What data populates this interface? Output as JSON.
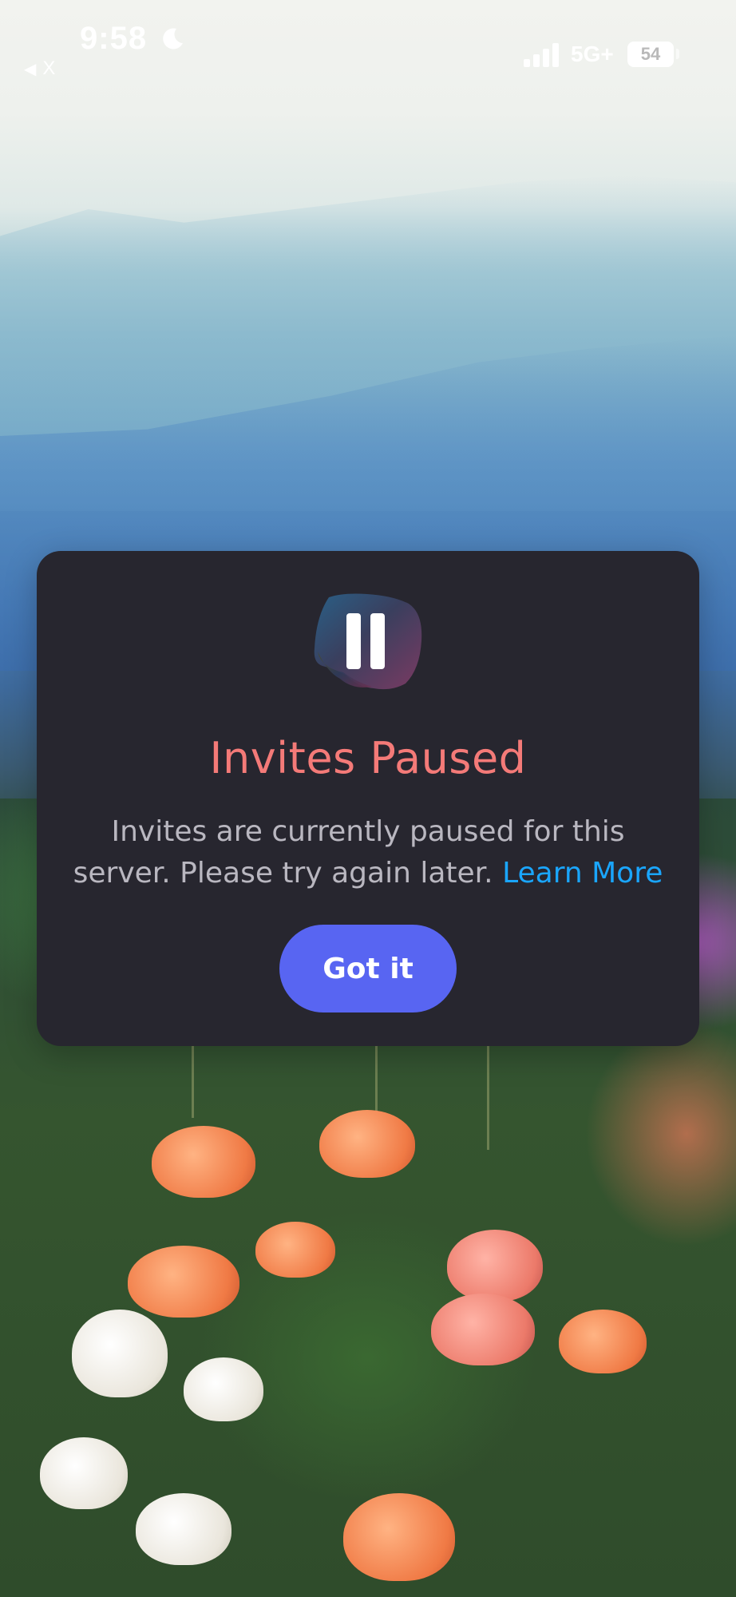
{
  "status_bar": {
    "time": "9:58",
    "back_arrow": "◀",
    "back_label": "X",
    "network": "5G+",
    "battery": "54",
    "icons": [
      "moon-icon",
      "signal-icon",
      "battery-icon"
    ]
  },
  "dialog": {
    "icon": "pause-icon",
    "title": "Invites Paused",
    "message": "Invites are currently paused for this server. Please try again later.",
    "link_label": "Learn More",
    "button_label": "Got it",
    "colors": {
      "background": "#27262f",
      "title": "#f47a78",
      "body_text": "#b9b7c0",
      "link": "#1aa6ff",
      "button": "#5865f2"
    }
  }
}
